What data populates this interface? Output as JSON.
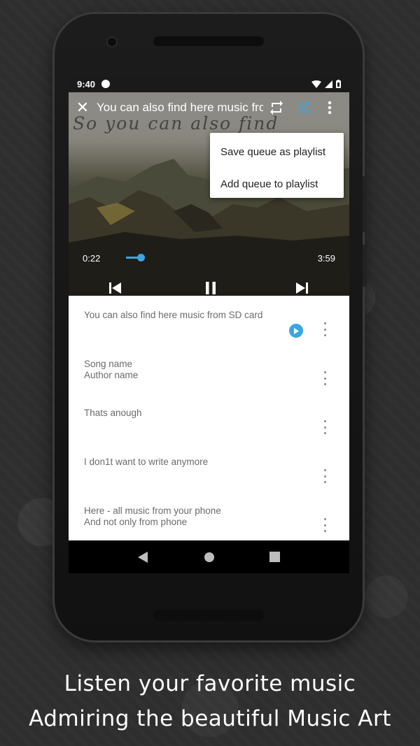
{
  "status_bar": {
    "time": "9:40"
  },
  "player": {
    "title": "You can also find here  music from SD card",
    "art_text": "So you can also find",
    "current_time": "0:22",
    "total_time": "3:59",
    "progress": 0.09,
    "accent": "#3aa6e3"
  },
  "overflow_menu": {
    "items": [
      "Save queue as playlist",
      "Add queue to playlist"
    ]
  },
  "queue": [
    {
      "line1": "You can also find here  music from SD card",
      "line2": ""
    },
    {
      "line1": "Song name",
      "line2": "Author name"
    },
    {
      "line1": "Thats anough",
      "line2": ""
    },
    {
      "line1": "I don1t want to write anymore",
      "line2": ""
    },
    {
      "line1": "Here - all music from your phone",
      "line2": "And not only from phone"
    }
  ],
  "caption": {
    "line1": "Listen your favorite music",
    "line2": "Admiring the beautiful Music Art"
  }
}
